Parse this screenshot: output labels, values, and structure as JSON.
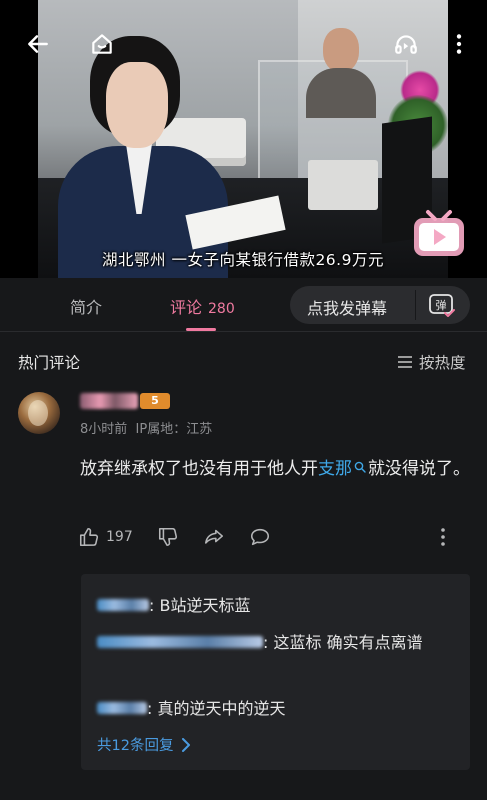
{
  "video": {
    "caption": "湖北鄂州 一女子向某银行借款26.9万元",
    "buttons": [
      "back-icon",
      "home-icon",
      "listen-icon",
      "more-vertical-icon"
    ],
    "logo": "bilibili-tv-icon"
  },
  "tabs": {
    "intro": "简介",
    "comments": "评论",
    "comments_count": "280",
    "danmaku_placeholder": "点我发弹幕",
    "danmaku_icon_text": "弹"
  },
  "hot": {
    "title": "热门评论",
    "sort_label": "按热度"
  },
  "comment": {
    "level": "5",
    "time": "8小时前",
    "ip": "IP属地：江苏",
    "text_part1": "放弃继承权了也没有用于他人开",
    "link_text": "支那",
    "text_part2": "就没得说了。",
    "likes": "197"
  },
  "replies": {
    "items": [
      {
        "text": ": B站逆天标蓝"
      },
      {
        "text": ": 这蓝标 确实有点离谱"
      },
      {
        "text": ": 真的逆天中的逆天"
      }
    ],
    "more_label": "共12条回复"
  }
}
